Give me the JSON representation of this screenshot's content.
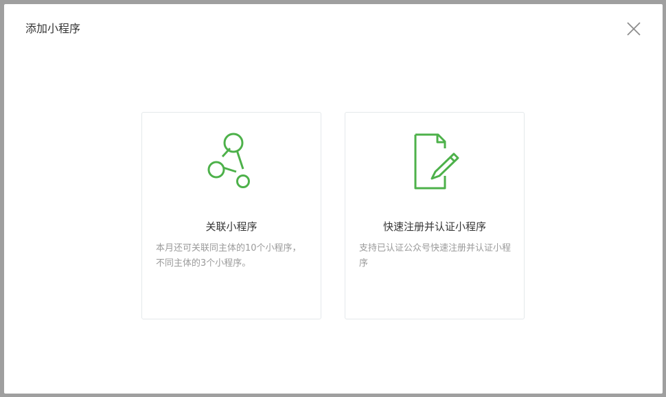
{
  "dialog": {
    "title": "添加小程序",
    "close_icon": "close-icon"
  },
  "cards": [
    {
      "icon": "link-network-icon",
      "title": "关联小程序",
      "description": "本月还可关联同主体的10个小程序，不同主体的3个小程序。"
    },
    {
      "icon": "document-edit-icon",
      "title": "快速注册并认证小程序",
      "description": "支持已认证公众号快速注册并认证小程序"
    }
  ],
  "colors": {
    "accent": "#4db14a",
    "title_text": "#353535",
    "desc_text": "#9a9a9a",
    "card_border": "#e4e8eb"
  }
}
